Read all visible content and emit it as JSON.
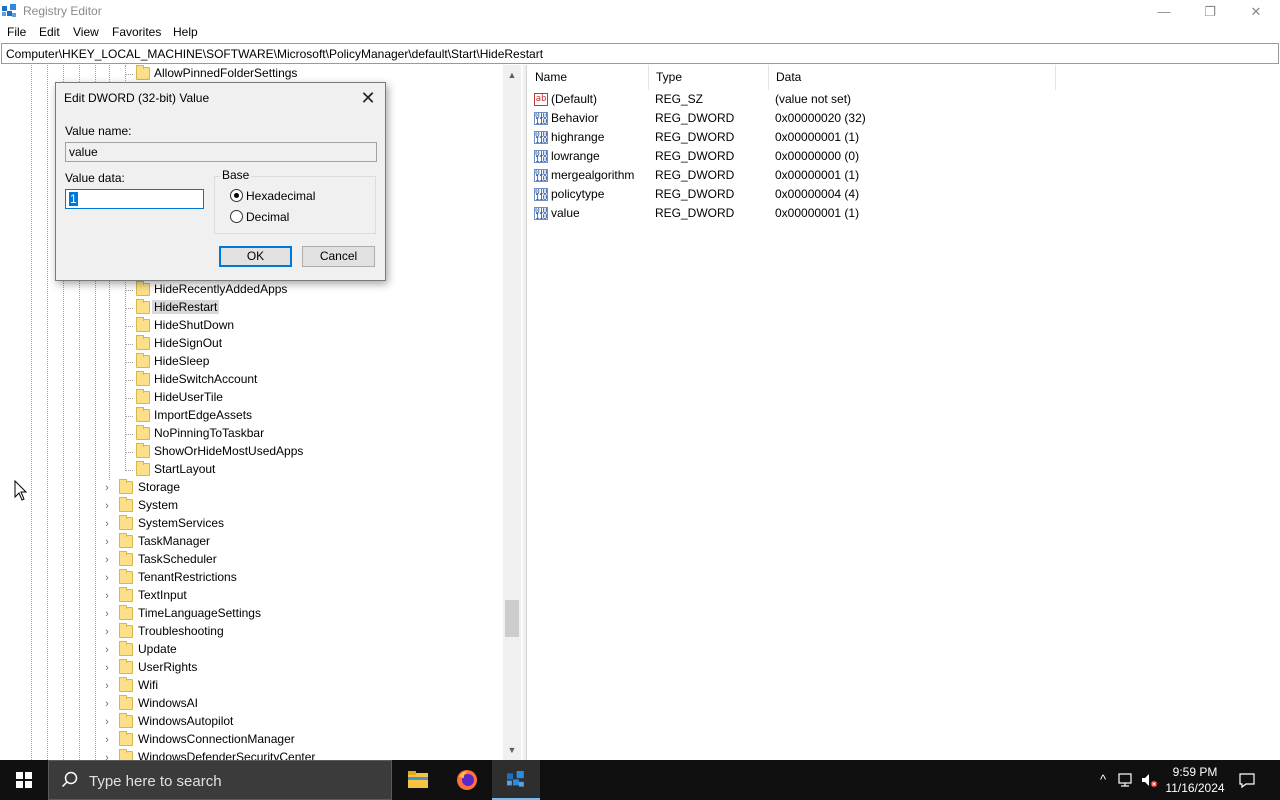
{
  "window": {
    "title": "Registry Editor",
    "minimize_glyph": "—",
    "restore_glyph": "❐",
    "close_glyph": "✕"
  },
  "menu": [
    "File",
    "Edit",
    "View",
    "Favorites",
    "Help"
  ],
  "address": "Computer\\HKEY_LOCAL_MACHINE\\SOFTWARE\\Microsoft\\PolicyManager\\default\\Start\\HideRestart",
  "tree": {
    "top_item": "AllowPinnedFolderSettings",
    "start_children": [
      "HideRecentlyAddedApps",
      "HideRestart",
      "HideShutDown",
      "HideSignOut",
      "HideSleep",
      "HideSwitchAccount",
      "HideUserTile",
      "ImportEdgeAssets",
      "NoPinningToTaskbar",
      "ShowOrHideMostUsedApps",
      "StartLayout"
    ],
    "selected": "HideRestart",
    "siblings": [
      "Storage",
      "System",
      "SystemServices",
      "TaskManager",
      "TaskScheduler",
      "TenantRestrictions",
      "TextInput",
      "TimeLanguageSettings",
      "Troubleshooting",
      "Update",
      "UserRights",
      "Wifi",
      "WindowsAI",
      "WindowsAutopilot",
      "WindowsConnectionManager",
      "WindowsDefenderSecurityCenter"
    ]
  },
  "list": {
    "columns": [
      "Name",
      "Type",
      "Data"
    ],
    "rows": [
      {
        "name": "(Default)",
        "type": "REG_SZ",
        "data": "(value not set)",
        "icon": "string-value-icon"
      },
      {
        "name": "Behavior",
        "type": "REG_DWORD",
        "data": "0x00000020 (32)",
        "icon": "binary-value-icon"
      },
      {
        "name": "highrange",
        "type": "REG_DWORD",
        "data": "0x00000001 (1)",
        "icon": "binary-value-icon"
      },
      {
        "name": "lowrange",
        "type": "REG_DWORD",
        "data": "0x00000000 (0)",
        "icon": "binary-value-icon"
      },
      {
        "name": "mergealgorithm",
        "type": "REG_DWORD",
        "data": "0x00000001 (1)",
        "icon": "binary-value-icon"
      },
      {
        "name": "policytype",
        "type": "REG_DWORD",
        "data": "0x00000004 (4)",
        "icon": "binary-value-icon"
      },
      {
        "name": "value",
        "type": "REG_DWORD",
        "data": "0x00000001 (1)",
        "icon": "binary-value-icon"
      }
    ]
  },
  "dialog": {
    "title": "Edit DWORD (32-bit) Value",
    "value_name_label": "Value name:",
    "value_name": "value",
    "value_data_label": "Value data:",
    "value_data": "1",
    "base_label": "Base",
    "hex_label": "Hexadecimal",
    "dec_label": "Decimal",
    "base_selected": "Hexadecimal",
    "ok": "OK",
    "cancel": "Cancel"
  },
  "taskbar": {
    "search_placeholder": "Type here to search",
    "time": "9:59 PM",
    "date": "11/16/2024",
    "apps": [
      "file-explorer-icon",
      "firefox-icon",
      "registry-editor-icon"
    ],
    "active_app": "registry-editor-icon"
  },
  "colors": {
    "accent": "#0078d7",
    "folder": "#fbe089",
    "taskbar": "#101010"
  }
}
